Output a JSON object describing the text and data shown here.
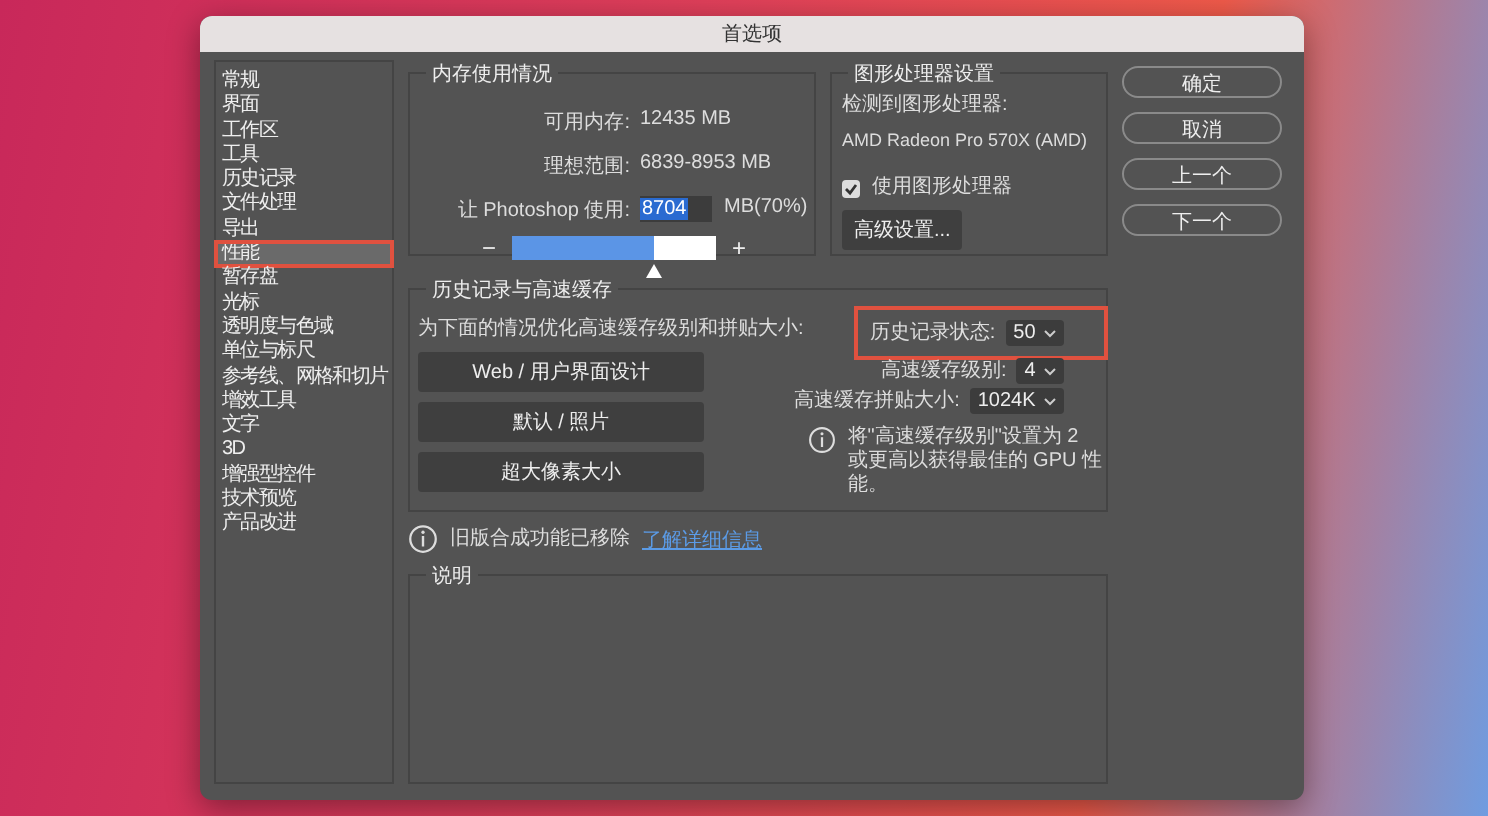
{
  "window": {
    "title": "首选项"
  },
  "sidebar": {
    "items": [
      {
        "label": "常规",
        "selected": false,
        "highlighted": false
      },
      {
        "label": "界面",
        "selected": false,
        "highlighted": false
      },
      {
        "label": "工作区",
        "selected": false,
        "highlighted": false
      },
      {
        "label": "工具",
        "selected": false,
        "highlighted": false
      },
      {
        "label": "历史记录",
        "selected": false,
        "highlighted": false
      },
      {
        "label": "文件处理",
        "selected": false,
        "highlighted": false
      },
      {
        "label": "导出",
        "selected": false,
        "highlighted": false
      },
      {
        "label": "性能",
        "selected": true,
        "highlighted": true
      },
      {
        "label": "暂存盘",
        "selected": false,
        "highlighted": false
      },
      {
        "label": "光标",
        "selected": false,
        "highlighted": false
      },
      {
        "label": "透明度与色域",
        "selected": false,
        "highlighted": false
      },
      {
        "label": "单位与标尺",
        "selected": false,
        "highlighted": false
      },
      {
        "label": "参考线、网格和切片",
        "selected": false,
        "highlighted": false
      },
      {
        "label": "增效工具",
        "selected": false,
        "highlighted": false
      },
      {
        "label": "文字",
        "selected": false,
        "highlighted": false
      },
      {
        "label": "3D",
        "selected": false,
        "highlighted": false
      },
      {
        "label": "增强型控件",
        "selected": false,
        "highlighted": false
      },
      {
        "label": "技术预览",
        "selected": false,
        "highlighted": false
      },
      {
        "label": "产品改进",
        "selected": false,
        "highlighted": false
      }
    ]
  },
  "memory": {
    "title": "内存使用情况",
    "available_label": "可用内存:",
    "available": "12435 MB",
    "ideal_label": "理想范围:",
    "ideal": "6839-8953 MB",
    "use_label": "让 Photoshop 使用:",
    "use_value": "8704",
    "use_unit": "MB(70%)",
    "minus": "−",
    "plus": "+",
    "level": 0.7
  },
  "gpu": {
    "title": "图形处理器设置",
    "detected_label": "检测到图形处理器:",
    "detected": "AMD Radeon Pro 570X (AMD)",
    "use_gpu": {
      "label": "使用图形处理器",
      "checked": true
    },
    "advanced_button": "高级设置..."
  },
  "history_cache": {
    "title": "历史记录与高速缓存",
    "optimize_label": "为下面的情况优化高速缓存级别和拼贴大小:",
    "presets": [
      "Web / 用户界面设计",
      "默认 / 照片",
      "超大像素大小"
    ],
    "fields": [
      {
        "label": "历史记录状态:",
        "value": "50",
        "highlighted": true
      },
      {
        "label": "高速缓存级别:",
        "value": "4",
        "highlighted": false
      },
      {
        "label": "高速缓存拼贴大小:",
        "value": "1024K",
        "highlighted": false
      }
    ],
    "tip": "将\"高速缓存级别\"设置为 2 或更高以获得最佳的 GPU 性能。"
  },
  "notice": {
    "text": "旧版合成功能已移除",
    "link": "了解详细信息"
  },
  "description": {
    "title": "说明"
  },
  "buttons": [
    "确定",
    "取消",
    "上一个",
    "下一个"
  ]
}
